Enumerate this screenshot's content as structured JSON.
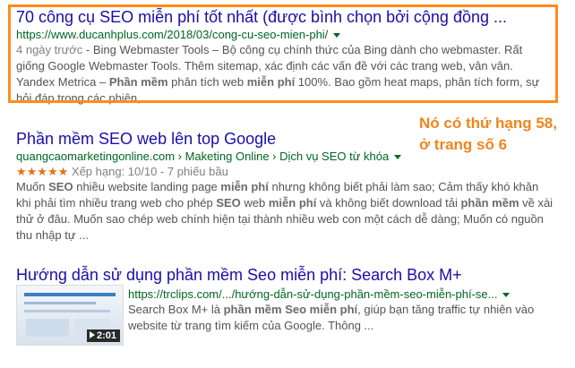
{
  "results": [
    {
      "title": "70 công cụ SEO miễn phí tốt nhất (được bình chọn bởi cộng đồng ...",
      "url": "https://www.ducanhplus.com/2018/03/cong-cu-seo-mien-phi/",
      "date": "4 ngày trước",
      "snippet_parts": [
        " - Bing Webmaster Tools – Bộ công cụ chính thức của Bing dành cho webmaster. Rất giống Google Webmaster Tools. Thêm sitemap, xác định các vấn đề với các trang web, vân vân. Yandex Metrica – ",
        "Phần mềm",
        " phân tích web ",
        "miễn phí",
        " 100%. Bao gồm heat maps, phân tích form, sự hỏi đáp trong các phiên, ..."
      ]
    },
    {
      "title": "Phần mềm SEO web lên top Google",
      "url": "quangcaomarketingonline.com › Maketing Online › Dịch vụ SEO từ khóa",
      "stars": "★★★★★",
      "rating": "Xếp hạng: 10/10 - 7 phiếu bầu",
      "snippet_parts": [
        "Muốn ",
        "SEO",
        " nhiều website landing page ",
        "miễn phí",
        " nhưng không biết phải làm sao; Cảm thấy khó khăn khi phải tìm nhiều trang web cho phép ",
        "SEO",
        " web ",
        "miễn phí",
        " và không biết download tải ",
        "phần mềm",
        " về xài thử ở đâu. Muốn sao chép web chính hiện tại thành nhiều web con một cách dễ dàng; Muốn có nguồn thu nhập tự ..."
      ]
    },
    {
      "title": "Hướng dẫn sử dụng phần mềm Seo miễn phí: Search Box M+",
      "url": "https://trclips.com/.../hướng-dẫn-sử-dụng-phần-mềm-seo-miễn-phí-se...",
      "duration": "2:01",
      "snippet_parts": [
        "Search Box M+ là ",
        "phần mềm",
        " ",
        "Seo miễn phí",
        ", giúp bạn tăng traffic tự nhiên vào website từ trang tìm kiếm của Google. Thông ..."
      ]
    }
  ],
  "annotation": {
    "line1": "Nó có thứ hạng 58,",
    "line2": "ở trang số 6"
  },
  "colors": {
    "title": "#1a0dab",
    "url": "#006621",
    "highlight": "#ff8c1a",
    "annotation": "#f0851c",
    "stars": "#e7711b"
  },
  "icons": [
    "dropdown-caret-icon",
    "star-icon",
    "play-icon"
  ]
}
